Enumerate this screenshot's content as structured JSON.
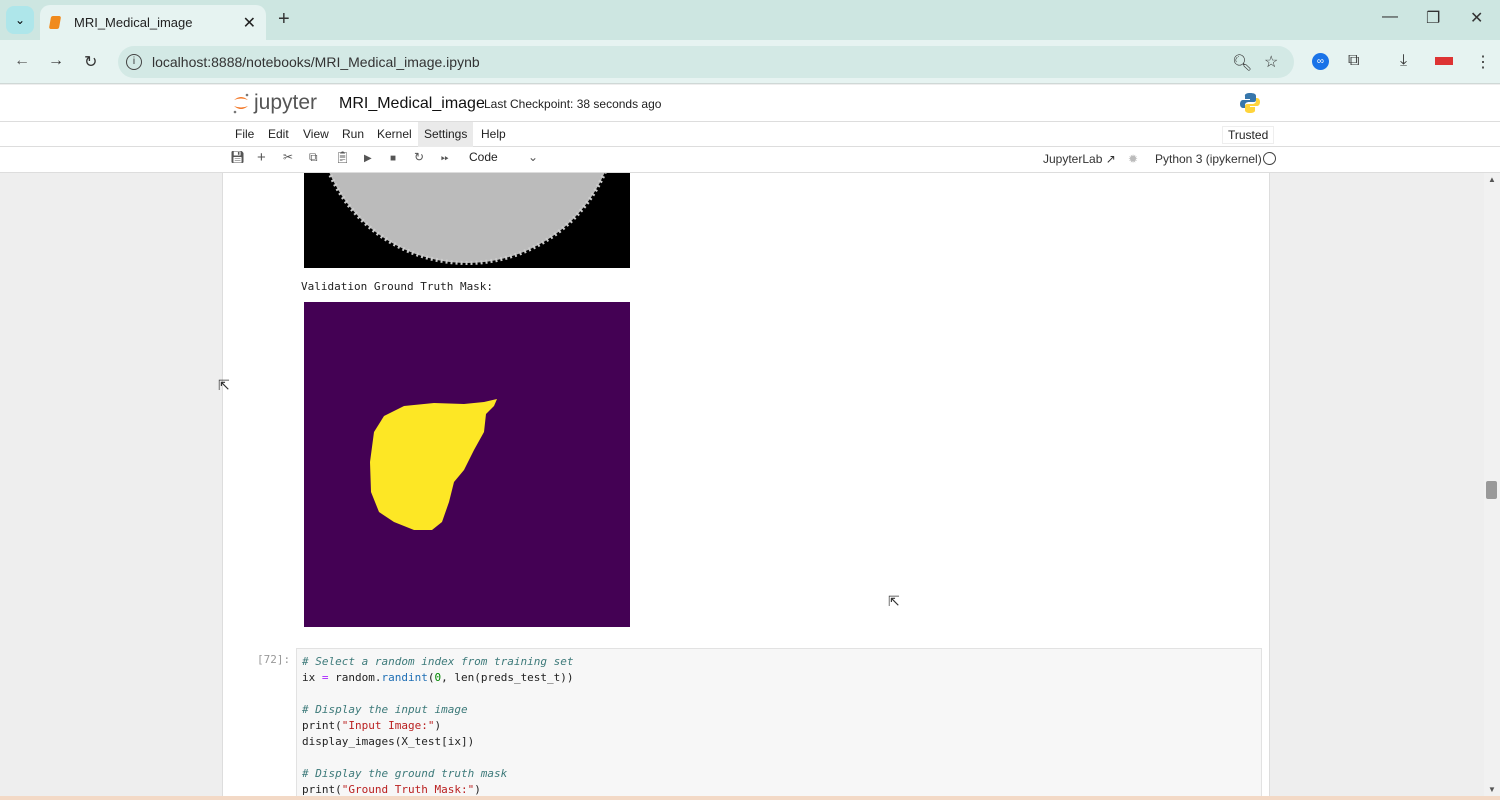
{
  "browser": {
    "tab_title": "MRI_Medical_image",
    "url": "localhost:8888/notebooks/MRI_Medical_image.ipynb"
  },
  "jupyter": {
    "logo_text": "jupyter",
    "notebook_title": "MRI_Medical_image",
    "checkpoint": "Last Checkpoint: 38 seconds ago",
    "menu": [
      "File",
      "Edit",
      "View",
      "Run",
      "Kernel",
      "Settings",
      "Help"
    ],
    "trusted": "Trusted",
    "cell_type": "Code",
    "jupyterlab_link": "JupyterLab",
    "kernel": "Python 3 (ipykernel)"
  },
  "output": {
    "label": "Validation Ground Truth Mask:"
  },
  "cell": {
    "prompt": "[72]:",
    "lines": [
      [
        {
          "t": "# Select a random index from training set",
          "c": "cm"
        }
      ],
      [
        {
          "t": "ix "
        },
        {
          "t": "=",
          "c": "op"
        },
        {
          "t": " random."
        },
        {
          "t": "randint",
          "c": "fn"
        },
        {
          "t": "("
        },
        {
          "t": "0",
          "c": "nu"
        },
        {
          "t": ", len(preds_test_t))"
        }
      ],
      [],
      [
        {
          "t": "# Display the input image",
          "c": "cm"
        }
      ],
      [
        {
          "t": "print("
        },
        {
          "t": "\"Input Image:\"",
          "c": "st"
        },
        {
          "t": ")"
        }
      ],
      [
        {
          "t": "display_images(X_test[ix])"
        }
      ],
      [],
      [
        {
          "t": "# Display the ground truth mask",
          "c": "cm"
        }
      ],
      [
        {
          "t": "print("
        },
        {
          "t": "\"Ground Truth Mask:\"",
          "c": "st"
        },
        {
          "t": ")"
        }
      ]
    ]
  },
  "colors": {
    "mask_bg": "#440154",
    "mask_fg": "#fde725"
  }
}
